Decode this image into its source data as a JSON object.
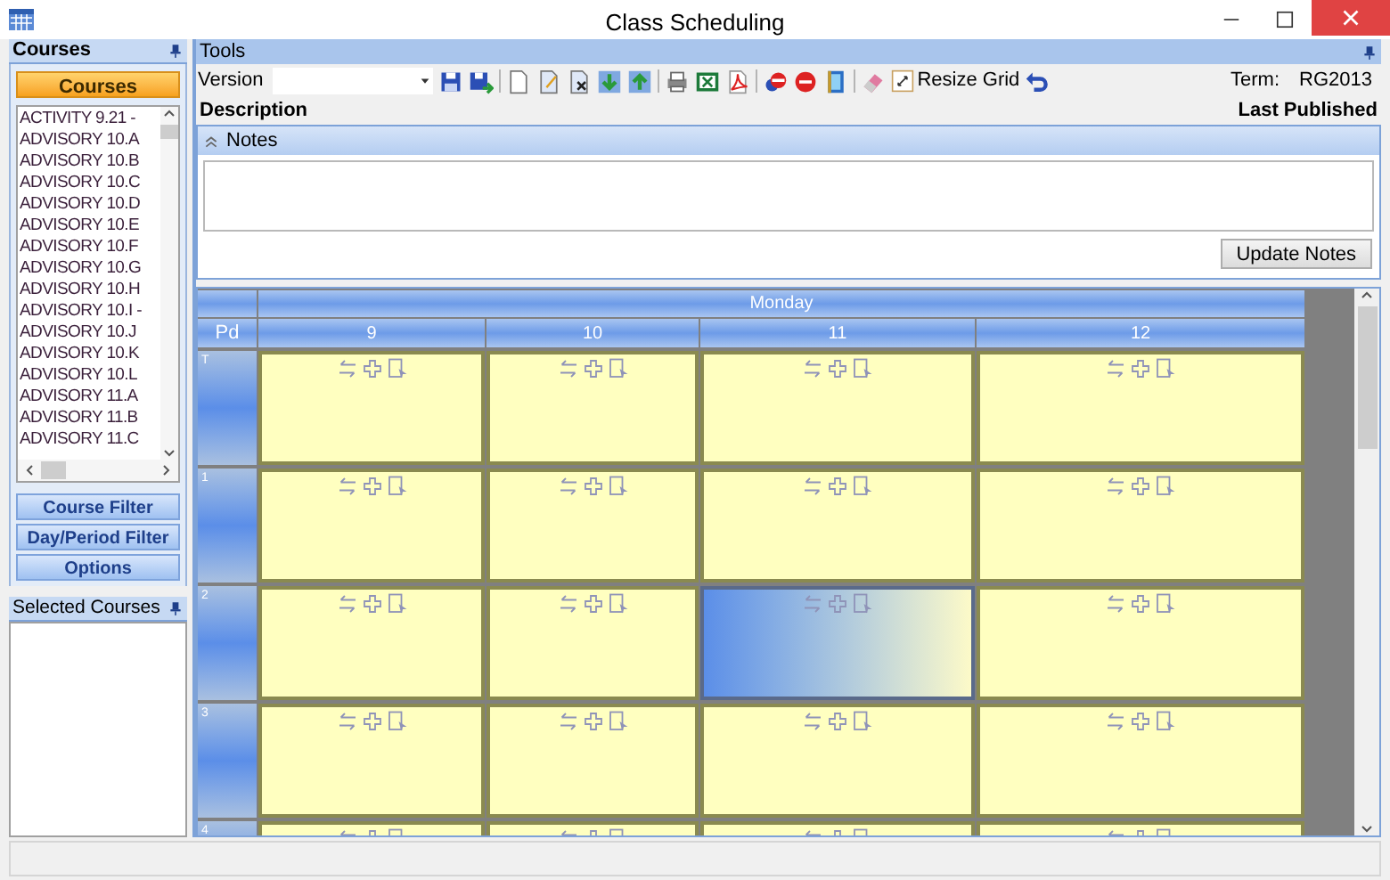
{
  "window": {
    "title": "Class Scheduling"
  },
  "courses_panel": {
    "title": "Courses",
    "button": "Courses",
    "items": [
      "ACTIVITY 9.21 -",
      "ADVISORY 10.A",
      "ADVISORY 10.B",
      "ADVISORY 10.C",
      "ADVISORY 10.D",
      "ADVISORY 10.E",
      "ADVISORY 10.F",
      "ADVISORY 10.G",
      "ADVISORY 10.H",
      "ADVISORY 10.I -",
      "ADVISORY 10.J",
      "ADVISORY 10.K",
      "ADVISORY 10.L",
      "ADVISORY 11.A",
      "ADVISORY 11.B",
      "ADVISORY 11.C"
    ],
    "filters": [
      "Course Filter",
      "Day/Period Filter",
      "Options"
    ]
  },
  "selected_courses_panel": {
    "title": "Selected Courses"
  },
  "tools": {
    "title": "Tools",
    "version_label": "Version",
    "resize_button": "Resize Grid",
    "term_label": "Term:",
    "term_value": "RG2013",
    "description_label": "Description",
    "last_published_label": "Last Published",
    "notes_title": "Notes",
    "update_button": "Update Notes"
  },
  "grid": {
    "day": "Monday",
    "period_header": "Pd",
    "columns": [
      "9",
      "10",
      "11",
      "12"
    ],
    "rows": [
      {
        "label": "T",
        "cells": [
          {
            "selected": false
          },
          {
            "selected": false
          },
          {
            "selected": false
          },
          {
            "selected": false
          }
        ]
      },
      {
        "label": "1",
        "cells": [
          {
            "selected": false
          },
          {
            "selected": false
          },
          {
            "selected": false
          },
          {
            "selected": false
          }
        ]
      },
      {
        "label": "2",
        "cells": [
          {
            "selected": false
          },
          {
            "selected": false
          },
          {
            "selected": true
          },
          {
            "selected": false
          }
        ]
      },
      {
        "label": "3",
        "cells": [
          {
            "selected": false
          },
          {
            "selected": false
          },
          {
            "selected": false
          },
          {
            "selected": false
          }
        ]
      },
      {
        "label": "4",
        "cells": [
          {
            "selected": false
          },
          {
            "selected": false
          },
          {
            "selected": false
          },
          {
            "selected": false
          }
        ]
      }
    ]
  }
}
